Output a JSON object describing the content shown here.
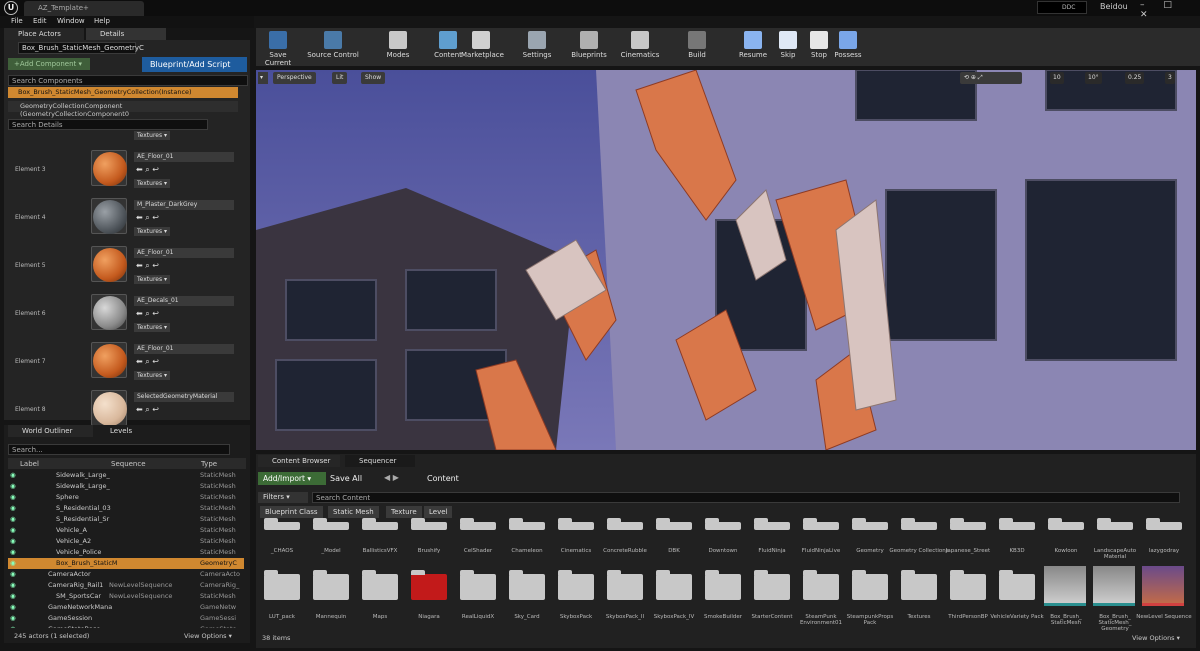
{
  "app": {
    "project_tab": "AZ_Template+",
    "ddc": "DDC",
    "user": "Beidou",
    "window_controls": "– □ ✕"
  },
  "menu": [
    "File",
    "Edit",
    "Window",
    "Help"
  ],
  "left_tabs": {
    "place_actors": "Place Actors",
    "details": "Details"
  },
  "details": {
    "actor_name": "Box_Brush_StaticMesh_GeometryC",
    "add_component": "+Add Component ▾",
    "blueprint_button": "Blueprint/Add Script",
    "search_components": "Search Components",
    "instance_row": "Box_Brush_StaticMesh_GeometryCollection(Instance)",
    "component_row": "GeometryCollectionComponent (GeometryCollectionComponent0",
    "search_details": "Search Details",
    "textures_label": "Textures ▾",
    "elements": [
      {
        "label": "Element 3",
        "material": "AE_Floor_01",
        "kind": "orange"
      },
      {
        "label": "Element 4",
        "material": "M_Plaster_DarkGrey",
        "kind": "grey"
      },
      {
        "label": "Element 5",
        "material": "AE_Floor_01",
        "kind": "orange"
      },
      {
        "label": "Element 6",
        "material": "AE_Decals_01",
        "kind": "decal"
      },
      {
        "label": "Element 7",
        "material": "AE_Floor_01",
        "kind": "orange"
      },
      {
        "label": "Element 8",
        "material": "SelectedGeometryMaterial",
        "kind": "beige"
      }
    ]
  },
  "toolbar": [
    {
      "label": "Save Current",
      "icon": "save-icon"
    },
    {
      "label": "Source Control",
      "icon": "source-control-icon"
    },
    {
      "label": "Modes",
      "icon": "modes-icon"
    },
    {
      "label": "Content",
      "icon": "content-icon"
    },
    {
      "label": "Marketplace",
      "icon": "marketplace-icon"
    },
    {
      "label": "Settings",
      "icon": "settings-icon"
    },
    {
      "label": "Blueprints",
      "icon": "blueprints-icon"
    },
    {
      "label": "Cinematics",
      "icon": "cinematics-icon"
    },
    {
      "label": "Build",
      "icon": "build-icon"
    },
    {
      "label": "Resume",
      "icon": "resume-icon"
    },
    {
      "label": "Skip",
      "icon": "skip-icon"
    },
    {
      "label": "Stop",
      "icon": "stop-icon"
    },
    {
      "label": "Possess",
      "icon": "possess-icon"
    }
  ],
  "viewport": {
    "perspective": "Perspective",
    "lit": "Lit",
    "show": "Show",
    "grid_snap": "10",
    "rot_snap": "10°",
    "scale_snap": "0.25",
    "cam_speed": "3"
  },
  "outliner": {
    "tab_world": "World Outliner",
    "tab_levels": "Levels",
    "search": "Search...",
    "columns": [
      "Label",
      "Sequence",
      "Type"
    ],
    "rows": [
      {
        "label": "Sidewalk_Large_",
        "seq": "",
        "type": "StaticMesh",
        "sel": false
      },
      {
        "label": "Sidewalk_Large_",
        "seq": "",
        "type": "StaticMesh",
        "sel": false
      },
      {
        "label": "Sphere",
        "seq": "",
        "type": "StaticMesh",
        "sel": false
      },
      {
        "label": "S_Residential_03",
        "seq": "",
        "type": "StaticMesh",
        "sel": false
      },
      {
        "label": "S_Residential_Sr",
        "seq": "",
        "type": "StaticMesh",
        "sel": false
      },
      {
        "label": "Vehicle_A",
        "seq": "",
        "type": "StaticMesh",
        "sel": false
      },
      {
        "label": "Vehicle_A2",
        "seq": "",
        "type": "StaticMesh",
        "sel": false
      },
      {
        "label": "Vehicle_Police",
        "seq": "",
        "type": "StaticMesh",
        "sel": false
      },
      {
        "label": "Box_Brush_StaticM",
        "seq": "",
        "type": "GeometryC",
        "sel": true
      },
      {
        "label": "CameraActor",
        "seq": "",
        "type": "CameraActo",
        "sel": false
      },
      {
        "label": "CameraRig_Rail1",
        "seq": "NewLevelSequence",
        "type": "CameraRig_",
        "sel": false
      },
      {
        "label": "SM_SportsCar",
        "seq": "NewLevelSequence",
        "type": "StaticMesh",
        "sel": false
      },
      {
        "label": "GameNetworkMana",
        "seq": "",
        "type": "GameNetw",
        "sel": false
      },
      {
        "label": "GameSession",
        "seq": "",
        "type": "GameSessi",
        "sel": false
      },
      {
        "label": "GameStateBase",
        "seq": "",
        "type": "GameState",
        "sel": false
      }
    ],
    "footer": "245 actors (1 selected)",
    "view_options": "View Options ▾"
  },
  "content_browser": {
    "tab_cb": "Content Browser",
    "tab_seq": "Sequencer",
    "add_import": "Add/Import ▾",
    "save_all": "Save All",
    "path": "Content",
    "filters": "Filters ▾",
    "search": "Search Content",
    "filter_chips": [
      "Blueprint Class",
      "Static Mesh",
      "Texture",
      "Level"
    ],
    "row1": [
      "_CHAOS",
      "_Model",
      "BallisticsVFX",
      "Brushify",
      "CelShader",
      "Chameleon",
      "Cinematics",
      "ConcreteRubble",
      "DBK",
      "Downtown",
      "FluidNinja",
      "FluidNinjaLive",
      "Geometry",
      "Geometry Collections",
      "Japanese_Street",
      "KB3D",
      "Kowloon",
      "LandscapeAuto Material",
      "lazygodray"
    ],
    "row2": [
      "LUT_pack",
      "Mannequin",
      "Maps",
      "Niagara",
      "RealLiquidX",
      "Sky_Card",
      "SkyboxPack",
      "SkyboxPack_II",
      "SkyboxPack_IV",
      "SmokeBuilder",
      "StarterContent",
      "SteamPunk Environment01",
      "SteampunkProps Pack",
      "Textures",
      "ThirdPersonBP",
      "VehicleVariety Pack",
      "Box_Brush_ StaticMesh",
      "Box_Brush_ StaticMesh_ Geometry",
      "NewLevel Sequence"
    ],
    "count": "38 items",
    "view_options": "View Options ▾"
  }
}
